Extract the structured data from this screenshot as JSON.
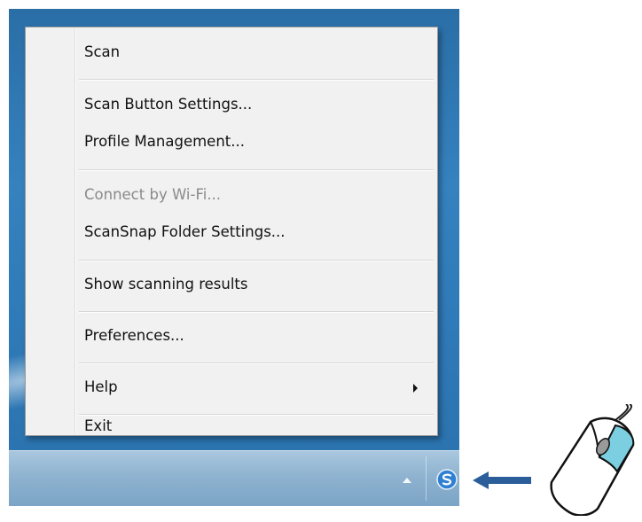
{
  "menu": {
    "items": [
      {
        "label": "Scan",
        "enabled": true
      },
      {
        "label": "Scan Button Settings...",
        "enabled": true
      },
      {
        "label": "Profile Management...",
        "enabled": true
      },
      {
        "label": "Connect by Wi-Fi...",
        "enabled": false
      },
      {
        "label": "ScanSnap Folder Settings...",
        "enabled": true
      },
      {
        "label": "Show scanning results",
        "enabled": true
      },
      {
        "label": "Preferences...",
        "enabled": true
      },
      {
        "label": "Help",
        "enabled": true,
        "submenu": true
      },
      {
        "label": "Exit",
        "enabled": true
      }
    ]
  },
  "tray": {
    "show_hidden_icon": "chevron-up-icon",
    "app_icon": "scansnap-manager-icon"
  },
  "annotation": {
    "arrow_icon": "left-arrow-icon",
    "mouse_icon": "mouse-right-click-icon"
  },
  "colors": {
    "desktop": "#2f7ab8",
    "taskbar": "#8fb3d0",
    "menu_bg": "#f1f1f1",
    "arrow": "#2a5d9a",
    "mouse_button": "#7ccfe0",
    "scansnap_icon": "#2f7fd3"
  }
}
